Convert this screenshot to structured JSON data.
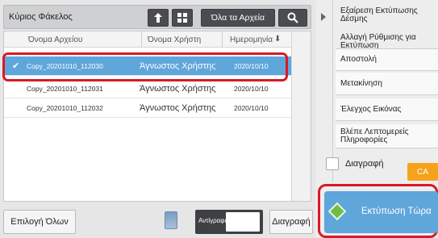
{
  "header": {
    "folder_title": "Κύριος Φάκελος",
    "all_files_label": "Όλα τα Αρχεία"
  },
  "list": {
    "columns": [
      "Όνομα Αρχείου",
      "Όνομα Χρήστη",
      "Ημερομηνία"
    ],
    "rows": [
      {
        "file": "Copy_20201010_112030",
        "user": "Άγνωστος Χρήστης",
        "date": "2020/10/10",
        "selected": true
      },
      {
        "file": "Copy_20201010_112031",
        "user": "Άγνωστος Χρήστης",
        "date": "2020/10/10",
        "selected": false
      },
      {
        "file": "Copy_20201010_112032",
        "user": "Άγνωστος Χρήστης",
        "date": "2020/10/10",
        "selected": false
      }
    ]
  },
  "bottom": {
    "select_all_label": "Επιλογή Όλων",
    "copies_label": "Αντίγραφα",
    "copies_value": "",
    "delete_label": "Διαγραφή"
  },
  "actions": {
    "items": [
      "Εξαίρεση Εκτύπωσης Δέσμης",
      "Αλλαγή Ρύθμισης για Εκτύπωση",
      "Αποστολή",
      "Μετακίνηση",
      "Έλεγχος Εικόνας",
      "Βλέπε Λεπτομερείς Πληροφορίες"
    ],
    "delete_option_label": "Διαγραφή",
    "ca_label": "CA",
    "print_now_label": "Εκτύπωση Τώρα"
  },
  "icons": {
    "up": "up-arrow-icon",
    "grid": "grid-icon",
    "search": "search-icon",
    "trash": "trash-icon",
    "print": "start-diamond-icon"
  },
  "colors": {
    "selection": "#5fa6db",
    "highlight_frame": "#d71a27",
    "ca_button": "#f6a21a",
    "start_icon": "#6fbe44"
  }
}
